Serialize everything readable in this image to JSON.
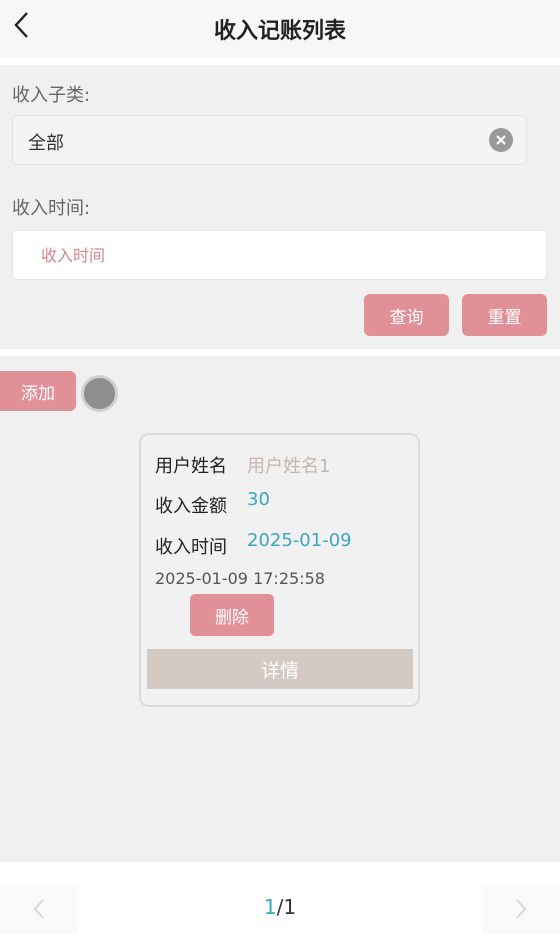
{
  "header": {
    "title": "收入记账列表"
  },
  "filter": {
    "subtype_label": "收入子类:",
    "subtype_value": "全部",
    "time_label": "收入时间:",
    "time_placeholder": "收入时间",
    "search_label": "查询",
    "reset_label": "重置"
  },
  "list": {
    "add_label": "添加",
    "records": [
      {
        "name_label": "用户姓名",
        "name_value": "用户姓名1",
        "amount_label": "收入金额",
        "amount_value": "30",
        "time_label": "收入时间",
        "time_value": "2025-01-09",
        "timestamp": "2025-01-09 17:25:58",
        "delete_label": "删除",
        "detail_label": "详情"
      }
    ]
  },
  "pager": {
    "current": "1",
    "total": "/1"
  },
  "colors": {
    "accent_pink": "#e29097",
    "value_teal": "#3aa7bd",
    "placeholder_gray": "#c0b7b2",
    "detail_bg": "#d4c9c3"
  },
  "icons": [
    "back-arrow-icon",
    "clear-icon",
    "chevron-left-icon",
    "chevron-right-icon"
  ]
}
